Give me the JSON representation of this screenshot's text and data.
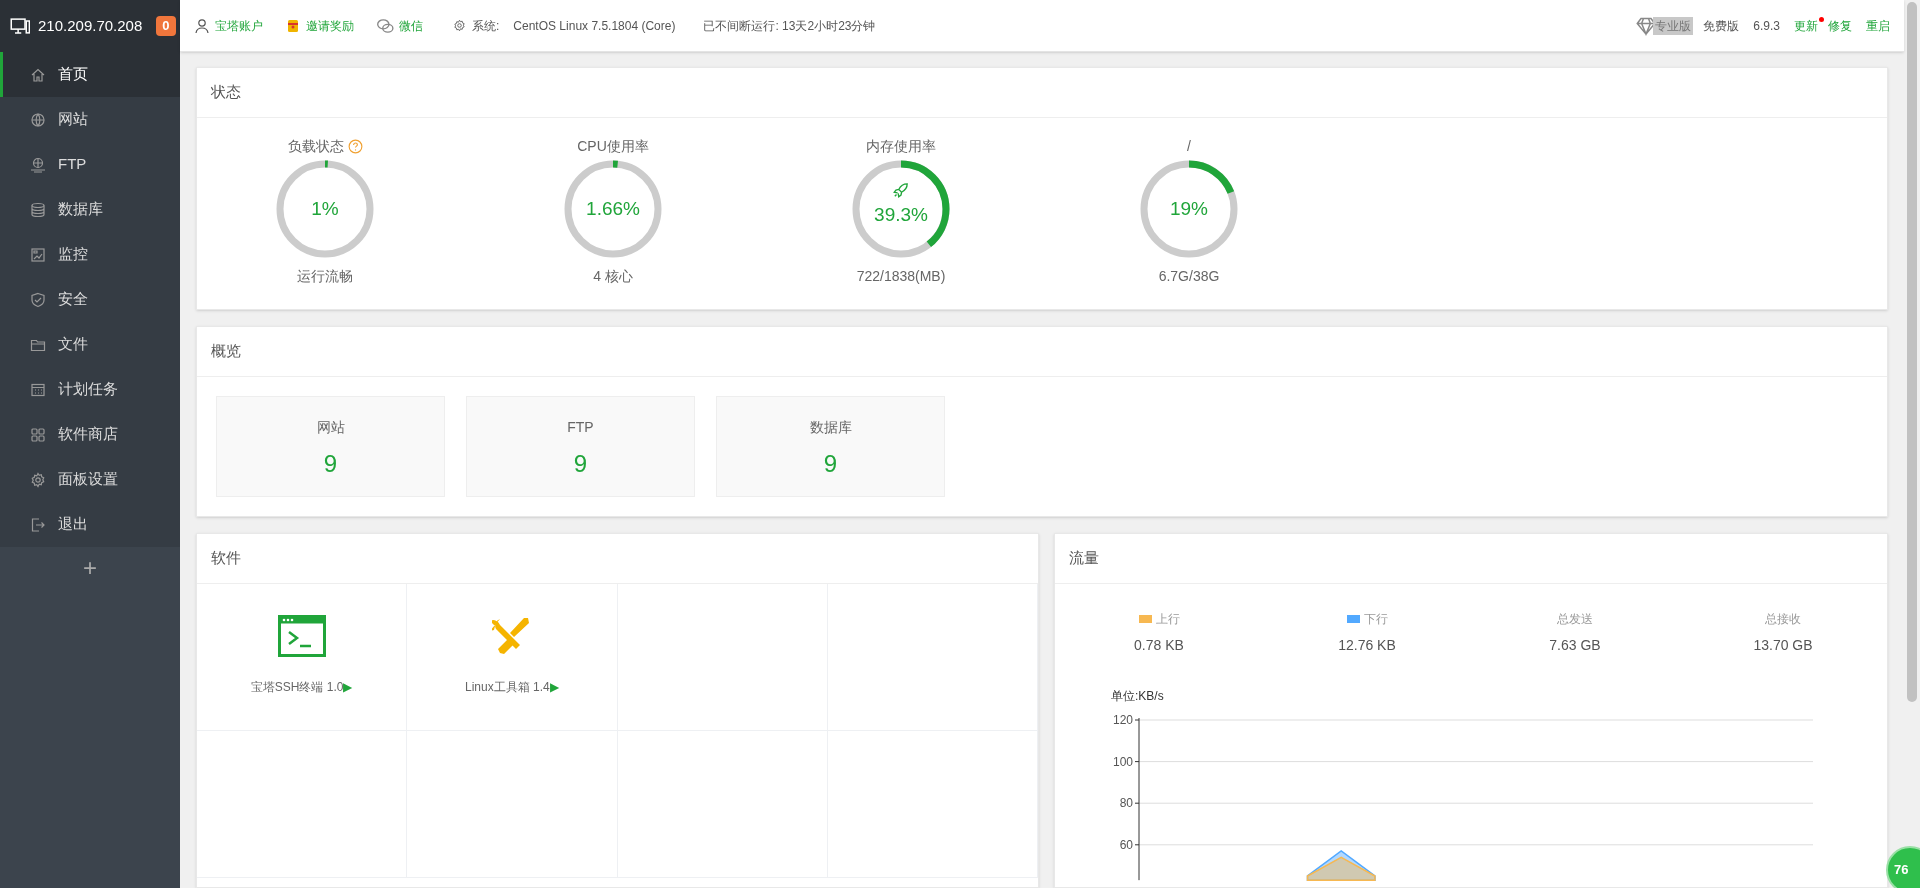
{
  "server": {
    "ip": "210.209.70.208",
    "alert_count": "0"
  },
  "sidebar": {
    "items": [
      {
        "label": "首页",
        "selected": true
      },
      {
        "label": "网站",
        "selected": false
      },
      {
        "label": "FTP",
        "selected": false
      },
      {
        "label": "数据库",
        "selected": false
      },
      {
        "label": "监控",
        "selected": false
      },
      {
        "label": "安全",
        "selected": false
      },
      {
        "label": "文件",
        "selected": false
      },
      {
        "label": "计划任务",
        "selected": false
      },
      {
        "label": "软件商店",
        "selected": false
      },
      {
        "label": "面板设置",
        "selected": false
      },
      {
        "label": "退出",
        "selected": false
      }
    ],
    "add_button": "+"
  },
  "top_bar": {
    "links": [
      "宝塔账户",
      "邀请奖励",
      "微信"
    ],
    "system_label": "系统:",
    "system_value": "CentOS Linux 7.5.1804 (Core)",
    "uptime": "已不间断运行: 13天2小时23分钟",
    "pro_badge": "专业版",
    "edition": "免费版",
    "version": "6.9.3",
    "actions": [
      {
        "label": "更新",
        "notify": true
      },
      {
        "label": "修复",
        "notify": false
      },
      {
        "label": "重启",
        "notify": false
      }
    ]
  },
  "status": {
    "title": "状态",
    "gauges": [
      {
        "label": "负载状态",
        "help": true,
        "value": "1%",
        "level": 0.01,
        "caption": "运行流畅",
        "boost": false
      },
      {
        "label": "CPU使用率",
        "help": false,
        "value": "1.66%",
        "level": 0.0166,
        "caption": "4 核心",
        "boost": false
      },
      {
        "label": "内存使用率",
        "help": false,
        "value": "39.3%",
        "level": 0.393,
        "caption": "722/1838(MB)",
        "boost": true
      },
      {
        "label": "/",
        "help": false,
        "value": "19%",
        "level": 0.19,
        "caption": "6.7G/38G",
        "boost": false
      }
    ]
  },
  "overview": {
    "title": "概览",
    "cards": [
      {
        "label": "网站",
        "value": "9"
      },
      {
        "label": "FTP",
        "value": "9"
      },
      {
        "label": "数据库",
        "value": "9"
      }
    ]
  },
  "software": {
    "title": "软件",
    "items": [
      {
        "name": "宝塔SSH终端 1.0",
        "mark": "▶"
      },
      {
        "name": "Linux工具箱 1.4",
        "mark": "▶"
      }
    ]
  },
  "traffic": {
    "title": "流量",
    "stats": [
      {
        "value": "0.78 KB"
      },
      {
        "value": "12.76 KB"
      },
      {
        "label": "总发送",
        "value": "7.63 GB"
      },
      {
        "label": "总接收",
        "value": "13.70 GB"
      }
    ],
    "chart_data": {
      "type": "area",
      "ylabel": "单位:KB/s",
      "ylim": [
        43,
        120
      ],
      "grid": true,
      "yticks": [
        60,
        80,
        100,
        120
      ],
      "series": [
        {
          "name": "上行",
          "color": "#f7b851",
          "values": [
            null,
            null,
            null,
            null,
            null,
            45,
            54,
            45,
            null,
            null,
            null,
            null,
            null,
            null,
            null,
            null,
            null,
            null,
            null,
            null,
            null
          ]
        },
        {
          "name": "下行",
          "color": "#52a9ff",
          "values": [
            null,
            null,
            null,
            null,
            null,
            45,
            57,
            45,
            null,
            null,
            null,
            null,
            null,
            null,
            null,
            null,
            null,
            null,
            null,
            null,
            null
          ]
        }
      ]
    }
  },
  "floating_badge": "76"
}
